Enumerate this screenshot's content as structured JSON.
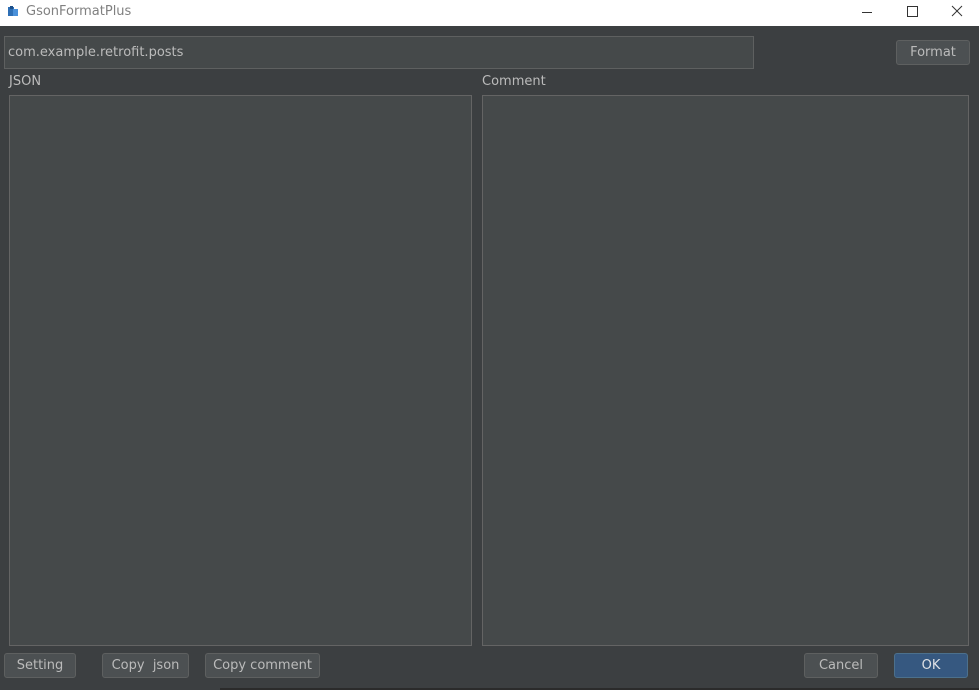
{
  "window": {
    "title": "GsonFormatPlus",
    "app_icon": "gsonformat-app-icon",
    "controls": [
      "minimize-icon",
      "maximize-icon",
      "close-icon"
    ]
  },
  "package_field": {
    "value": "com.example.retrofit.posts"
  },
  "buttons": {
    "format": "Format",
    "setting": "Setting",
    "copy_json": "Copy  json",
    "copy_comment": "Copy comment",
    "cancel": "Cancel",
    "ok": "OK"
  },
  "panels": {
    "json_label": "JSON",
    "json_value": "",
    "comment_label": "Comment",
    "comment_value": ""
  },
  "colors": {
    "background": "#3c3f41",
    "field": "#45494a",
    "button": "#4c5052",
    "primary_button": "#365880",
    "text": "#bbbbbb"
  }
}
